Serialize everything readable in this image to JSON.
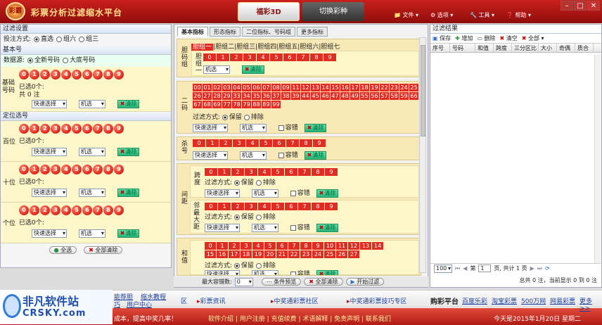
{
  "app": {
    "logo": "彩霸",
    "title": "彩票分析过滤缩水平台",
    "tab_active": "福彩3D",
    "tab_inactive": "切换彩种",
    "menus": [
      "文件",
      "选项",
      "工具",
      "帮助"
    ]
  },
  "left": {
    "filter_settings": "过滤设置",
    "bet_mode_label": "投注方式:",
    "bet_modes": [
      "直选",
      "组六",
      "组三"
    ],
    "basic_section": "基本号",
    "source_label": "数据源:",
    "sources": [
      "全新号码",
      "大底号码"
    ],
    "basic_label": "基础号码",
    "selected_zero": "已选0个:",
    "total_zero": "共 0 注",
    "digits": [
      "0",
      "1",
      "2",
      "3",
      "4",
      "5",
      "6",
      "7",
      "8",
      "9"
    ],
    "quick_select": "快速选择",
    "random": "机选",
    "clear": "清除",
    "position_section": "定位选号",
    "positions": [
      "百位",
      "十位",
      "个位"
    ],
    "select_all": "全选",
    "clear_all": "全部清除"
  },
  "mid": {
    "tabs": [
      "基本指标",
      "形态指标",
      "二位指标、号码组",
      "更多指标"
    ],
    "groups_label": "胆码组",
    "group1_label": "胆组一",
    "group_tabs": [
      "胆组一",
      "胆组二",
      "胆组三",
      "胆组四",
      "胆组五",
      "胆组六",
      "胆组七"
    ],
    "digits": [
      "0",
      "1",
      "2",
      "3",
      "4",
      "5",
      "6",
      "7",
      "8",
      "9"
    ],
    "random": "机选",
    "clear": "清除",
    "quick_select": "快速选择",
    "two_code_label": "二码",
    "two_codes": [
      "00",
      "01",
      "02",
      "03",
      "04",
      "05",
      "06",
      "07",
      "08",
      "09",
      "11",
      "12",
      "13",
      "14",
      "15",
      "16",
      "17",
      "18",
      "19",
      "22",
      "23",
      "24",
      "25",
      "26",
      "27",
      "28",
      "29",
      "33",
      "34",
      "35",
      "36",
      "37",
      "38",
      "39",
      "44",
      "45",
      "46",
      "47",
      "48",
      "49",
      "55",
      "56",
      "57",
      "58",
      "59",
      "66",
      "67",
      "68",
      "69",
      "77",
      "78",
      "79",
      "88",
      "89",
      "99"
    ],
    "filter_mode": "过滤方式:",
    "keep": "保留",
    "exclude": "排除",
    "tolerate": "容错",
    "kill_label": "杀号",
    "interval_label": "间距",
    "span_label": "跨度",
    "adjacent_label": "邻最大距",
    "sum_label": "和值",
    "sum_values": [
      "0",
      "1",
      "2",
      "3",
      "4",
      "5",
      "6",
      "7",
      "8",
      "9",
      "10",
      "11",
      "12",
      "13",
      "14",
      "15",
      "16",
      "17",
      "18",
      "19",
      "20",
      "21",
      "22",
      "23",
      "24",
      "25",
      "26",
      "27"
    ],
    "max_tolerance": "最大容错数:",
    "tolerance_value": "0",
    "preview": "条件预览",
    "clear_all": "全部清除",
    "start": "开始过滤"
  },
  "right": {
    "title": "过滤结果",
    "tools": [
      "保存",
      "增加",
      "删除",
      "清空",
      "全部"
    ],
    "columns": [
      "序号",
      "号码",
      "和值",
      "跨度",
      "三分区比",
      "大小",
      "奇偶",
      "质合"
    ],
    "page_size": "100",
    "page_prefix": "第",
    "page_value": "1",
    "page_suffix": "页, 共计 1 页",
    "summary": "总共 0 注，当前显示 0 到 0 注"
  },
  "footer": {
    "brand_cn": "非凡软件站",
    "brand_en": "CRSKY.com",
    "row1_links": [
      "能荐胆",
      "缩水教程",
      "巧",
      "用户中心"
    ],
    "news": [
      "彩票资讯",
      "中奖通彩票社区",
      "中奖通彩票技巧专区"
    ],
    "buy_label": "购彩平台",
    "buy_links": [
      "百度乐彩",
      "淘宝彩票",
      "500万网",
      "网易彩票",
      "更多>>"
    ],
    "row2_left": "成本，提高中奖几率！",
    "row2_links": [
      "软件介绍",
      "用户注册",
      "充值续费",
      "术语解释",
      "免责声明",
      "联系我们"
    ],
    "date": "今天是2015年1月20日 星期二"
  },
  "colors": {
    "titlebar": "#b01a17",
    "ball": "#e1271b",
    "panel": "#fdf6c9",
    "accent": "#27b57a"
  }
}
